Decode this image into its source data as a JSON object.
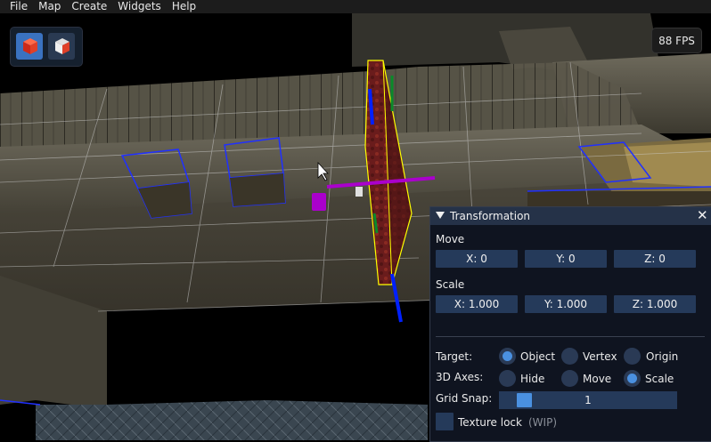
{
  "menu": [
    "File",
    "Map",
    "Create",
    "Widgets",
    "Help"
  ],
  "fps": "88 FPS",
  "toolbar": {
    "icons": [
      "red-cube-icon",
      "white-red-cube-icon"
    ]
  },
  "transformation": {
    "title": "Transformation",
    "move": {
      "label": "Move",
      "x": "X: 0",
      "y": "Y: 0",
      "z": "Z: 0"
    },
    "scale": {
      "label": "Scale",
      "x": "X: 1.000",
      "y": "Y: 1.000",
      "z": "Z: 1.000"
    },
    "target": {
      "label": "Target:",
      "options": [
        "Object",
        "Vertex",
        "Origin"
      ],
      "selected": "Object"
    },
    "axes": {
      "label": "3D Axes:",
      "options": [
        "Hide",
        "Move",
        "Scale"
      ],
      "selected": "Scale"
    },
    "grid_snap": {
      "label": "Grid Snap:",
      "value": "1"
    },
    "texture_lock": {
      "label": "Texture lock",
      "note": "(WIP)",
      "checked": false
    }
  },
  "colors": {
    "accent": "#4a90e0",
    "button": "#253a5a",
    "panel_header": "#253248",
    "selection_outline": "#ffff00",
    "gizmo_x": "#aa00cc",
    "gizmo_y": "#0a8a2a",
    "gizmo_z": "#0020ff"
  }
}
